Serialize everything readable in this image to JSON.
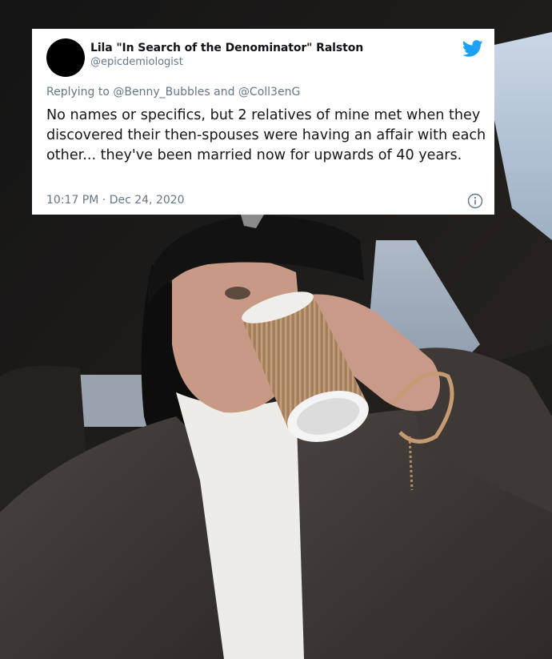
{
  "tweet": {
    "display_name": "Lila \"In Search of the Denominator\" Ralston",
    "handle": "@epicdemiologist",
    "reply_prefix": "Replying to",
    "reply_to": "@Benny_Bubbles and @Coll3enG",
    "text": "No names or specifics, but 2 relatives of mine met when they discovered their then-spouses were having an affair with each other... they've been married now for upwards of 40 years.",
    "time": "10:17 PM",
    "separator": "·",
    "date": "Dec 24, 2020"
  },
  "colors": {
    "twitter_blue": "#1da1f2",
    "text_primary": "#14171a",
    "text_secondary": "#657786"
  },
  "icons": [
    "twitter-bird-icon",
    "info-icon"
  ]
}
